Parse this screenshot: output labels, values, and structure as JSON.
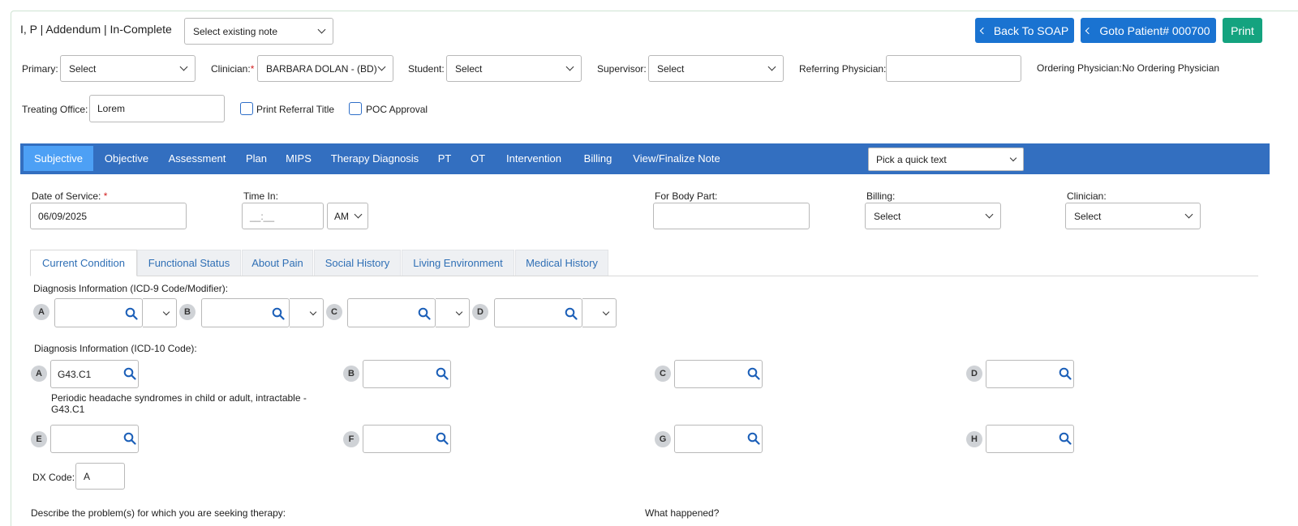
{
  "header": {
    "title": "I, P | Addendum | In-Complete",
    "note_select": "Select existing note",
    "back_button": "Back To SOAP",
    "goto_button": "Goto Patient# 000700",
    "print_button": "Print"
  },
  "form_top": {
    "primary_label": "Primary:",
    "primary_value": "Select",
    "clinician_label": "Clinician:",
    "clinician_value": "BARBARA DOLAN - (BD)",
    "student_label": "Student:",
    "student_value": "Select",
    "supervisor_label": "Supervisor:",
    "supervisor_value": "Select",
    "referring_label": "Referring Physician:",
    "referring_value": "",
    "ordering_label": "Ordering Physician:",
    "ordering_value": "No Ordering Physician",
    "treating_label": "Treating Office:",
    "treating_value": "Lorem",
    "print_referral_label": "Print Referral Title",
    "poc_label": "POC Approval",
    "required_mark": "*"
  },
  "nav": {
    "items": [
      "Subjective",
      "Objective",
      "Assessment",
      "Plan",
      "MIPS",
      "Therapy Diagnosis",
      "PT",
      "OT",
      "Intervention",
      "Billing",
      "View/Finalize Note"
    ],
    "active": "Subjective",
    "quick_text": "Pick a quick text"
  },
  "visit": {
    "dos_label": "Date of Service:",
    "dos_value": "06/09/2025",
    "time_label": "Time In:",
    "time_placeholder": "__:__",
    "ampm": "AM",
    "body_part_label": "For Body Part:",
    "billing_label": "Billing:",
    "billing_value": "Select",
    "clinician_label": "Clinician:",
    "clinician_value": "Select"
  },
  "subtabs": {
    "items": [
      "Current Condition",
      "Functional Status",
      "About Pain",
      "Social History",
      "Living Environment",
      "Medical History"
    ],
    "active": "Current Condition"
  },
  "icd9": {
    "label": "Diagnosis Information (ICD-9 Code/Modifier):",
    "letters": [
      "A",
      "B",
      "C",
      "D"
    ]
  },
  "icd10": {
    "label": "Diagnosis Information (ICD-10 Code):",
    "letters": [
      "A",
      "B",
      "C",
      "D",
      "E",
      "F",
      "G",
      "H"
    ],
    "a_value": "G43.C1",
    "a_description": "Periodic headache syndromes in child or adult, intractable - G43.C1"
  },
  "dx": {
    "label": "DX Code:",
    "value": "A"
  },
  "bottom": {
    "describe_label": "Describe the problem(s) for which you are seeking therapy:",
    "what_label": "What happened?"
  }
}
